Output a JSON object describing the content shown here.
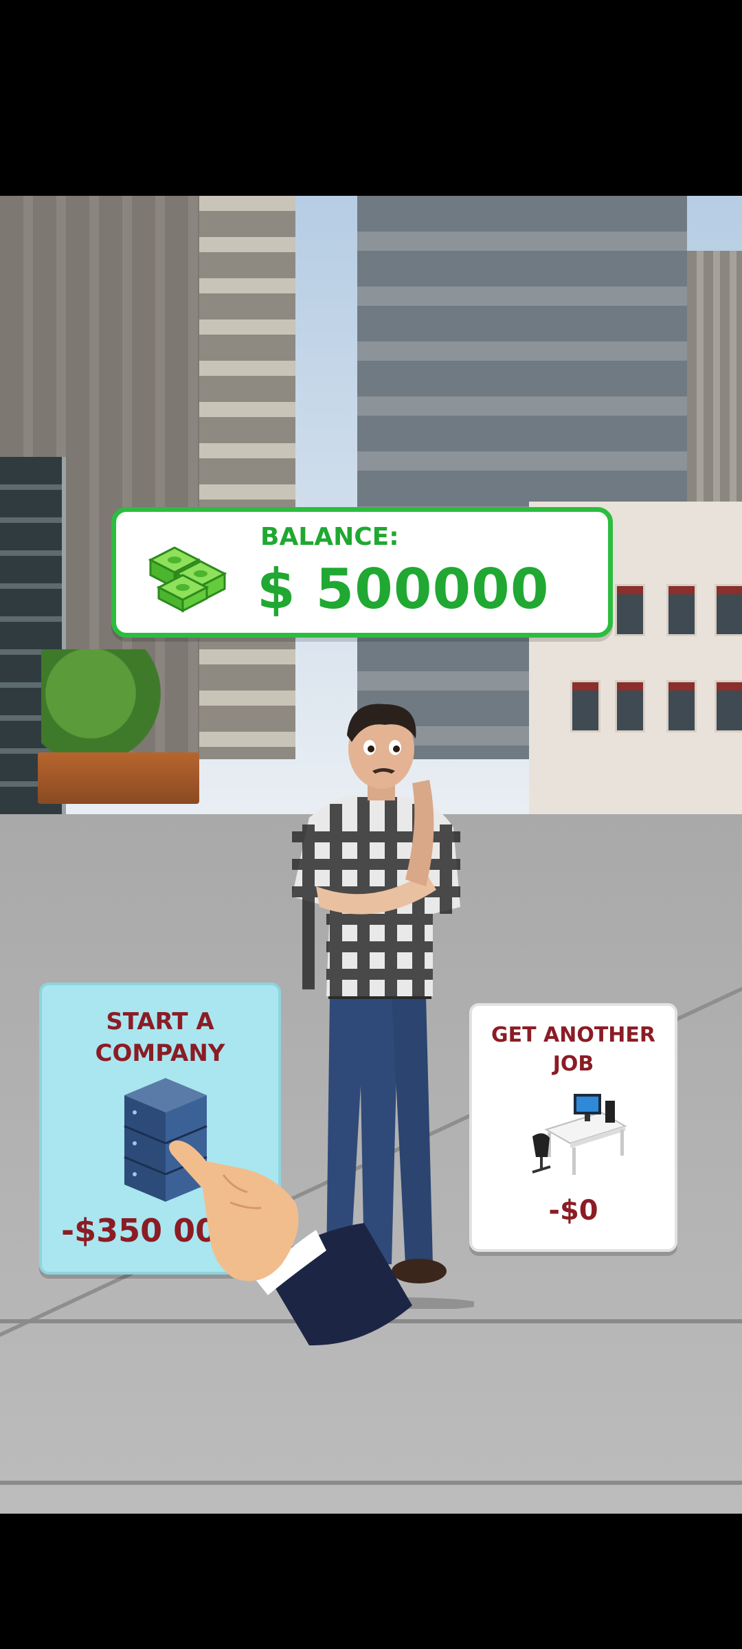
{
  "balance": {
    "label": "BALANCE:",
    "value": "$ 500000",
    "icon": "money-stack-icon"
  },
  "choices": [
    {
      "title_line1": "START A",
      "title_line2": "COMPANY",
      "price": "-$350 00",
      "icon": "server-rack-icon"
    },
    {
      "title_line1": "GET ANOTHER",
      "title_line2": "JOB",
      "price": "-$0",
      "icon": "office-desk-icon"
    }
  ],
  "tutorial": {
    "icon": "pointing-hand-icon"
  },
  "colors": {
    "balance_green": "#20a832",
    "card_title_red": "#8b1c25",
    "company_card_bg": "#a9e6ef",
    "job_card_bg": "#ffffff"
  }
}
